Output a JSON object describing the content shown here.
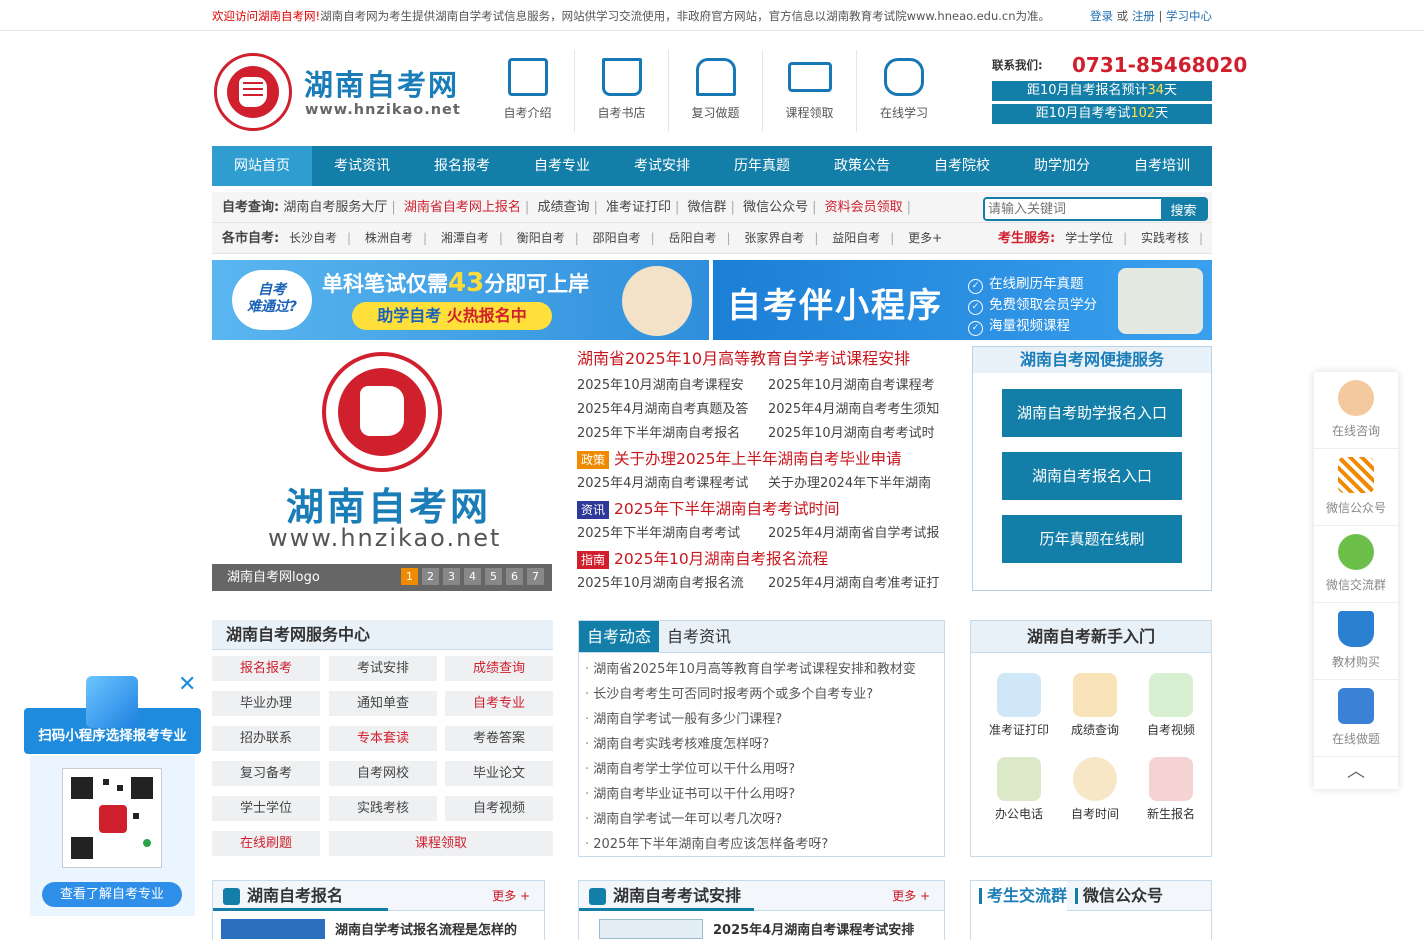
{
  "topbar": {
    "welcome": "欢迎访问湖南自考网!",
    "notice": "湖南自考网为考生提供湖南自学考试信息服务，网站供学习交流使用，非政府官方网站，官方信息以湖南教育考试院www.hneao.edu.cn为准。",
    "login": "登录",
    "or": "或",
    "register": "注册",
    "sep": "|",
    "study": "学习中心"
  },
  "header": {
    "logo_text": "湖南自考网",
    "domain": "www.hnzikao.net",
    "quicknav": [
      {
        "label": "自考介绍",
        "icon": "easel-icon"
      },
      {
        "label": "自考书店",
        "icon": "book-icon"
      },
      {
        "label": "复习做题",
        "icon": "school-icon"
      },
      {
        "label": "课程领取",
        "icon": "course-icon"
      },
      {
        "label": "在线学习",
        "icon": "study-icon"
      }
    ],
    "contact_label": "联系我们:",
    "phone": "0731-85468020",
    "count1_pre": "距10月自考报名预计",
    "count1_num": "34",
    "count1_suf": "天",
    "count2_pre": "距10月自考考试",
    "count2_num": "102",
    "count2_suf": "天"
  },
  "nav": [
    "网站首页",
    "考试资讯",
    "报名报考",
    "自考专业",
    "考试安排",
    "历年真题",
    "政策公告",
    "自考院校",
    "助学加分",
    "自考培训"
  ],
  "query": {
    "label": "自考查询:",
    "items": [
      {
        "t": "湖南自考服务大厅",
        "red": false
      },
      {
        "t": "湖南省自考网上报名",
        "red": true
      },
      {
        "t": "成绩查询",
        "red": false
      },
      {
        "t": "准考证打印",
        "red": false
      },
      {
        "t": "微信群",
        "red": false
      },
      {
        "t": "微信公众号",
        "red": false
      },
      {
        "t": "资料会员领取",
        "red": true
      }
    ],
    "search_placeholder": "请输入关键词",
    "search_btn": "搜索"
  },
  "cities": {
    "label": "各市自考:",
    "items": [
      "长沙自考",
      "株洲自考",
      "湘潭自考",
      "衡阳自考",
      "邵阳自考",
      "岳阳自考",
      "张家界自考",
      "益阳自考",
      "更多+"
    ],
    "service_label": "考生服务:",
    "service_items": [
      "学士学位",
      "实践考核"
    ]
  },
  "banner1": {
    "circle1": "自考",
    "circle2": "难通过?",
    "headline_pre": "单科笔试仅需",
    "headline_num": "43",
    "headline_suf": "分即可上岸",
    "pill_pre": "助学自考",
    "pill_suf": "火热报名中"
  },
  "banner2": {
    "title": "自考伴小程序",
    "f1": "在线刷历年真题",
    "f2": "免费领取会员学分",
    "f3": "海量视频课程"
  },
  "slide": {
    "brand": "湖南自考网",
    "domain": "www.hnzikao.net",
    "caption": "湖南自考网logo",
    "pages": [
      "1",
      "2",
      "3",
      "4",
      "5",
      "6",
      "7"
    ]
  },
  "news": {
    "headline": "湖南省2025年10月高等教育自学考试课程安排",
    "rows1": [
      [
        "2025年10月湖南自考课程安",
        "2025年10月湖南自考课程考"
      ],
      [
        "2025年4月湖南自考真题及答",
        "2025年4月湖南自考考生须知"
      ],
      [
        "2025年下半年湖南自考报名",
        "2025年10月湖南自考考试时"
      ]
    ],
    "policy_tag": "政策",
    "policy_title": "关于办理2025年上半年湖南自考毕业申请",
    "rows2": [
      [
        "2025年4月湖南自考课程考试",
        "关于办理2024年下半年湖南"
      ]
    ],
    "info_tag": "资讯",
    "info_title": "2025年下半年湖南自考考试时间",
    "rows3": [
      [
        "2025年下半年湖南自考考试",
        "2025年4月湖南省自学考试报"
      ]
    ],
    "guide_tag": "指南",
    "guide_title": "2025年10月湖南自考报名流程",
    "rows4": [
      [
        "2025年10月湖南自考报名流",
        "2025年4月湖南自考准考证打"
      ]
    ]
  },
  "services": {
    "title": "湖南自考网便捷服务",
    "b1": "湖南自考助学报名入口",
    "b2": "湖南自考报名入口",
    "b3": "历年真题在线刷"
  },
  "center": {
    "title": "湖南自考网服务中心",
    "grid": [
      {
        "t": "报名报考",
        "red": true
      },
      {
        "t": "考试安排",
        "red": false
      },
      {
        "t": "成绩查询",
        "red": true
      },
      {
        "t": "毕业办理",
        "red": false
      },
      {
        "t": "通知单查",
        "red": false
      },
      {
        "t": "自考专业",
        "red": true
      },
      {
        "t": "招办联系",
        "red": false
      },
      {
        "t": "专本套读",
        "red": true
      },
      {
        "t": "考卷答案",
        "red": false
      },
      {
        "t": "复习备考",
        "red": false
      },
      {
        "t": "自考网校",
        "red": false
      },
      {
        "t": "毕业论文",
        "red": false
      },
      {
        "t": "学士学位",
        "red": false
      },
      {
        "t": "实践考核",
        "red": false
      },
      {
        "t": "自考视频",
        "red": false
      }
    ],
    "last1": "在线刷题",
    "last2": "课程领取"
  },
  "dyn": {
    "tab1": "自考动态",
    "tab2": "自考资讯",
    "items": [
      "湖南省2025年10月高等教育自学考试课程安排和教材变",
      "长沙自考考生可否同时报考两个或多个自考专业?",
      "湖南自学考试一般有多少门课程?",
      "湖南自考实践考核难度怎样呀?",
      "湖南自考学士学位可以干什么用呀?",
      "湖南自考毕业证书可以干什么用呀?",
      "湖南自学考试一年可以考几次呀?",
      "2025年下半年湖南自考应该怎样备考呀?"
    ]
  },
  "newbie": {
    "title": "湖南自考新手入门",
    "items": [
      {
        "t": "准考证打印",
        "icon": "admission-ticket-icon"
      },
      {
        "t": "成绩查询",
        "icon": "score-search-icon"
      },
      {
        "t": "自考视频",
        "icon": "video-icon"
      },
      {
        "t": "办公电话",
        "icon": "telephone-icon"
      },
      {
        "t": "自考时间",
        "icon": "alarm-clock-icon"
      },
      {
        "t": "新生报名",
        "icon": "new-student-icon"
      }
    ]
  },
  "box1": {
    "title": "湖南自考报名",
    "more": "更多 +",
    "first": "湖南自学考试报名流程是怎样的"
  },
  "box2": {
    "title": "湖南自考考试安排",
    "more": "更多 +",
    "first": "2025年4月湖南自考课程考试安排"
  },
  "group": {
    "tab1": "考生交流群",
    "tab2": "微信公众号"
  },
  "side": [
    {
      "t": "在线咨询",
      "icon": "customer-service-icon"
    },
    {
      "t": "微信公众号",
      "icon": "qr-code-icon"
    },
    {
      "t": "微信交流群",
      "icon": "wechat-icon"
    },
    {
      "t": "教材购买",
      "icon": "cart-icon"
    },
    {
      "t": "在线做题",
      "icon": "exam-paper-icon"
    }
  ],
  "side_top": "︿",
  "mini": {
    "bar": "扫码小程序选择报考专业",
    "close": "✕",
    "btn": "查看了解自考专业"
  },
  "colors": {
    "primary": "#137fa8",
    "brand": "#1a7db8",
    "red": "#d0202e",
    "nav_active": "#2f9dcf"
  }
}
